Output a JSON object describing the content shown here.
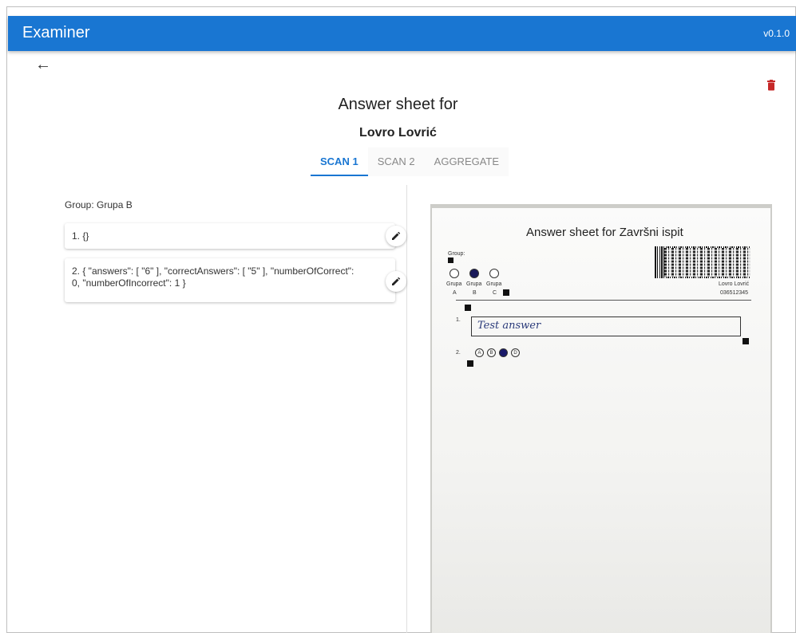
{
  "app": {
    "title": "Examiner",
    "version": "v0.1.0"
  },
  "header": {
    "title": "Answer sheet for",
    "student_name": "Lovro Lovrić"
  },
  "tabs": [
    {
      "label": "SCAN 1",
      "active": true
    },
    {
      "label": "SCAN 2",
      "active": false
    },
    {
      "label": "AGGREGATE",
      "active": false
    }
  ],
  "group": {
    "label": "Group: Grupa B"
  },
  "answers": [
    {
      "text": "1. {}"
    },
    {
      "text": "2. { \"answers\": [ \"6\" ], \"correctAnswers\": [ \"5\" ], \"numberOfCorrect\": 0, \"numberOfIncorrect\": 1 }"
    }
  ],
  "scan_image": {
    "title": "Answer sheet for Završni ispit",
    "group_label": "Group:",
    "group_options": [
      {
        "label": "Grupa",
        "letter": "A",
        "selected": false
      },
      {
        "label": "Grupa",
        "letter": "B",
        "selected": true
      },
      {
        "label": "Grupa",
        "letter": "C",
        "selected": false
      }
    ],
    "student_name": "Lovro Lovrić",
    "student_id": "036512345",
    "question_1_number": "1.",
    "question_1_answer": "Test answer",
    "question_2_number": "2.",
    "question_2_options": [
      {
        "letter": "A",
        "selected": false
      },
      {
        "letter": "B",
        "selected": false
      },
      {
        "letter": "C",
        "selected": true
      },
      {
        "letter": "D",
        "selected": false
      }
    ]
  },
  "colors": {
    "appbar": "#1976d2",
    "accent": "#1976d2",
    "delete": "#c62828"
  },
  "icons": {
    "back": "arrow-left-icon",
    "delete": "trash-icon",
    "edit": "pencil-icon"
  }
}
